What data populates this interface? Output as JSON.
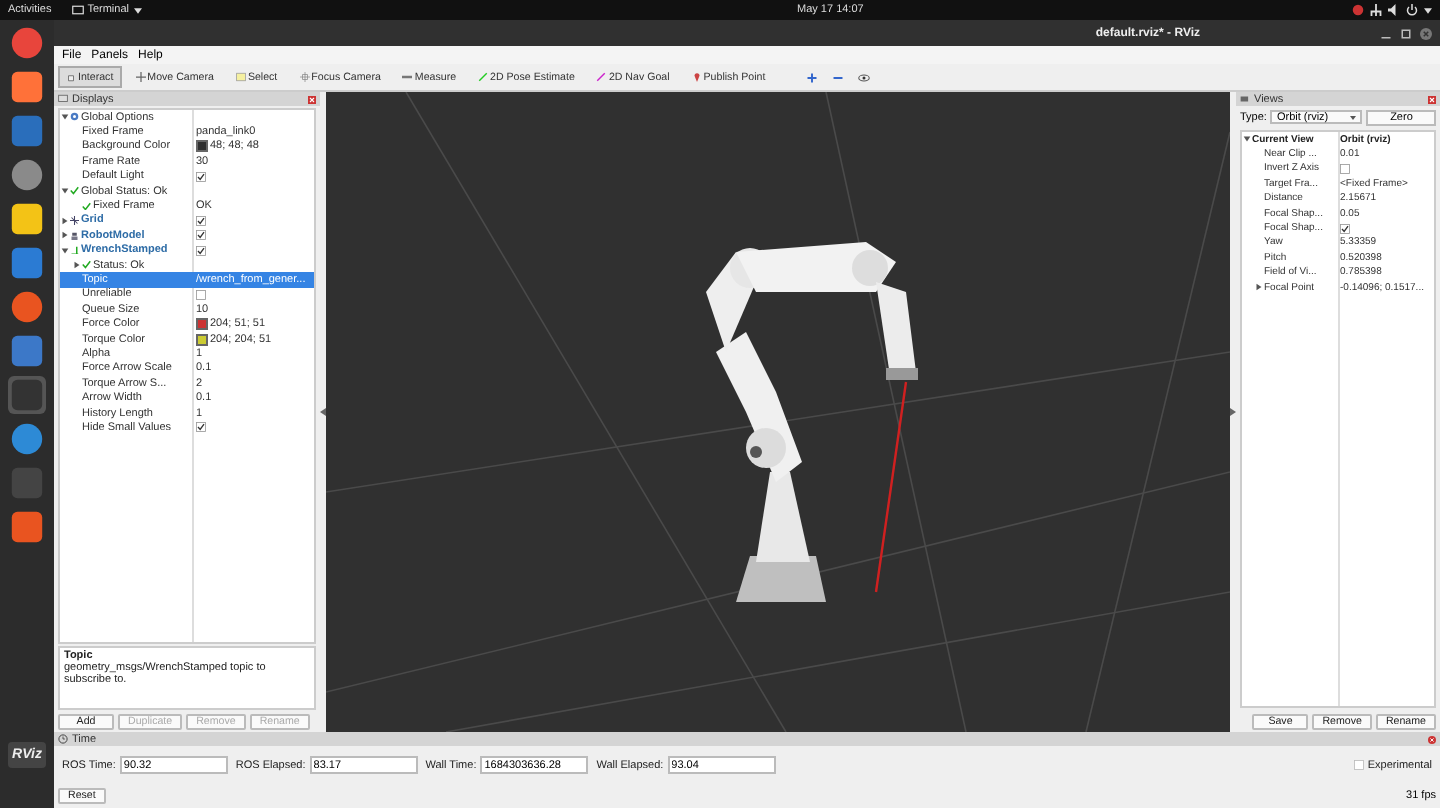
{
  "topbar": {
    "activities": "Activities",
    "app": "Terminal",
    "clock": "May 17  14:07"
  },
  "dock": {
    "logo_label": "RViz"
  },
  "window": {
    "title": "default.rviz* - RViz"
  },
  "menu": [
    "File",
    "Panels",
    "Help"
  ],
  "tools": [
    {
      "kind": "interact",
      "label": "Interact",
      "selected": true
    },
    {
      "kind": "move",
      "label": "Move Camera",
      "selected": false
    },
    {
      "kind": "select",
      "label": "Select",
      "selected": false
    },
    {
      "kind": "focus",
      "label": "Focus Camera",
      "selected": false
    },
    {
      "kind": "measure",
      "label": "Measure",
      "selected": false
    },
    {
      "kind": "pose",
      "label": "2D Pose Estimate",
      "selected": false
    },
    {
      "kind": "goal",
      "label": "2D Nav Goal",
      "selected": false
    },
    {
      "kind": "point",
      "label": "Publish Point",
      "selected": false
    }
  ],
  "displays": {
    "title": "Displays",
    "rows": [
      {
        "kind": "group",
        "label": "Global Options",
        "expanded": true,
        "selected": false,
        "children": [
          {
            "label": "Fixed Frame",
            "value": "panda_link0",
            "selected": false
          },
          {
            "label": "Background Color",
            "value": "48; 48; 48",
            "color": "#303030",
            "selected": false
          },
          {
            "label": "Frame Rate",
            "value": "30",
            "selected": false
          },
          {
            "label": "Default Light",
            "checked": true,
            "selected": false
          }
        ]
      },
      {
        "kind": "status",
        "label": "Global Status: Ok",
        "expanded": true,
        "selected": false,
        "children": [
          {
            "kind": "status",
            "label": "Fixed Frame",
            "value": "OK",
            "selected": false
          }
        ]
      },
      {
        "kind": "grid",
        "label": "Grid",
        "expanded": false,
        "checked": true,
        "selected": false
      },
      {
        "kind": "robot",
        "label": "RobotModel",
        "expanded": false,
        "checked": true,
        "selected": false
      },
      {
        "kind": "wrench",
        "label": "WrenchStamped",
        "expanded": true,
        "checked": true,
        "selected": false,
        "children": [
          {
            "kind": "status",
            "label": "Status: Ok",
            "expanded": false,
            "selected": false
          },
          {
            "label": "Topic",
            "value": "/wrench_from_gener...",
            "selected": true
          },
          {
            "label": "Unreliable",
            "checked": false,
            "selected": false
          },
          {
            "label": "Queue Size",
            "value": "10",
            "selected": false
          },
          {
            "label": "Force Color",
            "value": "204; 51; 51",
            "color": "#cc3333",
            "selected": false
          },
          {
            "label": "Torque Color",
            "value": "204; 204; 51",
            "color": "#cccc33",
            "selected": false
          },
          {
            "label": "Alpha",
            "value": "1",
            "selected": false
          },
          {
            "label": "Force Arrow Scale",
            "value": "0.1",
            "selected": false
          },
          {
            "label": "Torque Arrow S...",
            "value": "2",
            "selected": false
          },
          {
            "label": "Arrow Width",
            "value": "0.1",
            "selected": false
          },
          {
            "label": "History Length",
            "value": "1",
            "selected": false
          },
          {
            "label": "Hide Small Values",
            "checked": true,
            "selected": false
          }
        ]
      }
    ],
    "description_title": "Topic",
    "description": "geometry_msgs/WrenchStamped topic to subscribe to.",
    "buttons": [
      {
        "label": "Add",
        "disabled": false
      },
      {
        "label": "Duplicate",
        "disabled": true
      },
      {
        "label": "Remove",
        "disabled": true
      },
      {
        "label": "Rename",
        "disabled": true
      }
    ]
  },
  "views": {
    "title": "Views",
    "type_label": "Type:",
    "type_value": "Orbit (rviz)",
    "zero": "Zero",
    "rows": [
      {
        "kind": "header",
        "label": "Current View",
        "value": "Orbit (rviz)",
        "expanded": true,
        "selected": false,
        "children": [
          {
            "label": "Near Clip ...",
            "value": "0.01",
            "selected": false
          },
          {
            "label": "Invert Z Axis",
            "checked": false,
            "selected": false
          },
          {
            "label": "Target Fra...",
            "value": "<Fixed Frame>",
            "selected": false
          },
          {
            "label": "Distance",
            "value": "2.15671",
            "selected": false
          },
          {
            "label": "Focal Shap...",
            "value": "0.05",
            "selected": false
          },
          {
            "label": "Focal Shap...",
            "checked": true,
            "selected": false
          },
          {
            "label": "Yaw",
            "value": "5.33359",
            "selected": false
          },
          {
            "label": "Pitch",
            "value": "0.520398",
            "selected": false
          },
          {
            "label": "Field of Vi...",
            "value": "0.785398",
            "selected": false
          },
          {
            "label": "Focal Point",
            "value": "-0.14096; 0.1517...",
            "expanded": false,
            "selected": false
          }
        ]
      }
    ],
    "buttons": [
      "Save",
      "Remove",
      "Rename"
    ]
  },
  "time": {
    "title": "Time",
    "fields": [
      {
        "label": "ROS Time:",
        "value": "90.32"
      },
      {
        "label": "ROS Elapsed:",
        "value": "83.17"
      },
      {
        "label": "Wall Time:",
        "value": "1684303636.28"
      },
      {
        "label": "Wall Elapsed:",
        "value": "93.04"
      }
    ],
    "experimental": {
      "label": "Experimental",
      "checked": false
    },
    "reset": "Reset",
    "fps": "31 fps"
  }
}
